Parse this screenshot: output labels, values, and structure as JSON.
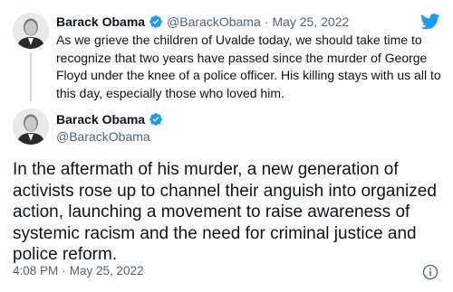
{
  "tweet_reply": {
    "author_name": "Barack Obama",
    "author_handle": "@BarackObama",
    "separator": "·",
    "date": "May 25, 2022",
    "text_lines": [
      "As we grieve the children of Uvalde today, we should take time to",
      "recognize that two years have passed since the murder of George",
      "Floyd under the knee of a police officer. His killing stays with us all to",
      "this day, especially those who loved him."
    ]
  },
  "tweet_main": {
    "author_name": "Barack Obama",
    "author_handle": "@BarackObama",
    "text_lines": [
      "In the aftermath of his murder, a new generation of",
      "activists rose up to channel their anguish into organized",
      "action, launching a movement to raise awareness of",
      "systemic racism and the need for criminal justice and",
      "police reform."
    ],
    "time": "4:08 PM",
    "separator": "·",
    "date": "May 25, 2022"
  },
  "icons": {
    "logo": "twitter-bird-icon",
    "verified": "verified-badge-icon",
    "info": "info-icon"
  },
  "colors": {
    "twitter_blue": "#1d9bf0",
    "text_primary": "#0f1419",
    "text_secondary": "#536471",
    "thread_line": "#cfd9de"
  }
}
